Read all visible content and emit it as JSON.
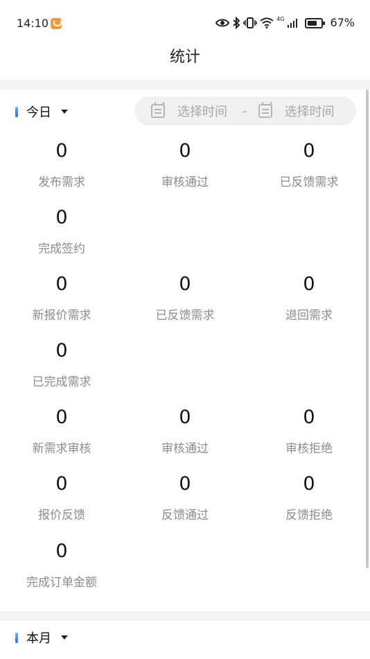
{
  "status_bar": {
    "time": "14:10",
    "icons": [
      "eye-icon",
      "bluetooth-icon",
      "vibrate-icon",
      "wifi-icon",
      "signal-icon",
      "battery-icon"
    ],
    "network_type": "4G",
    "battery": "67%"
  },
  "nav": {
    "title": "统计"
  },
  "today_section": {
    "period": "今日",
    "date_range": {
      "start_placeholder": "选择时间",
      "separator": "-",
      "end_placeholder": "选择时间"
    },
    "stats": [
      {
        "value": "0",
        "label": "发布需求"
      },
      {
        "value": "0",
        "label": "审核通过"
      },
      {
        "value": "0",
        "label": "已反馈需求"
      },
      {
        "value": "0",
        "label": "完成签约"
      },
      {
        "value": "0",
        "label": "新报价需求"
      },
      {
        "value": "0",
        "label": "已反馈需求"
      },
      {
        "value": "0",
        "label": "退回需求"
      },
      {
        "value": "0",
        "label": "已完成需求"
      },
      {
        "value": "0",
        "label": "新需求审核"
      },
      {
        "value": "0",
        "label": "审核通过"
      },
      {
        "value": "0",
        "label": "审核拒绝"
      },
      {
        "value": "0",
        "label": "报价反馈"
      },
      {
        "value": "0",
        "label": "反馈通过"
      },
      {
        "value": "0",
        "label": "反馈拒绝"
      },
      {
        "value": "0",
        "label": "完成订单金额"
      }
    ]
  },
  "month_section": {
    "period": "本月"
  },
  "colors": {
    "accent": "#2a6fd6",
    "label_gray": "#8c8c8c",
    "band_gray": "#f4f4f4"
  }
}
